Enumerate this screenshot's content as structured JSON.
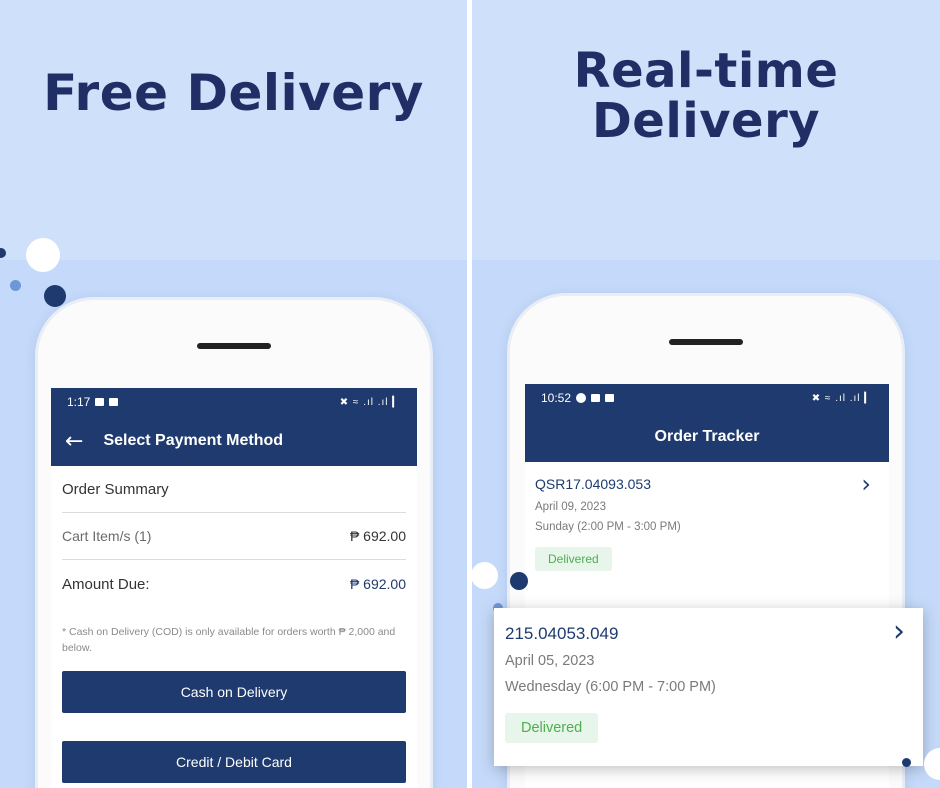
{
  "left_panel": {
    "headline": "Free Delivery",
    "status_time": "1:17",
    "status_icons": "✖ ≈ .ıl .ıl ▎",
    "appbar_title": "Select Payment Method",
    "order_summary_label": "Order Summary",
    "cart_items_label": "Cart Item/s (1)",
    "cart_items_amount": "₱ 692.00",
    "amount_due_label": "Amount Due:",
    "amount_due_value": "₱ 692.00",
    "cod_note": "* Cash on Delivery (COD) is only available for orders worth ₱ 2,000 and below.",
    "cod_button": "Cash on Delivery",
    "card_button": "Credit / Debit Card"
  },
  "right_panel": {
    "headline_line1": "Real-time",
    "headline_line2": "Delivery",
    "status_time": "10:52",
    "status_icons": "✖ ≈ .ıl .ıl ▎",
    "appbar_title": "Order Tracker",
    "orders": [
      {
        "id": "QSR17.04093.053",
        "date": "April 09, 2023",
        "slot": "Sunday (2:00 PM - 3:00 PM)",
        "status": "Delivered"
      },
      {
        "id": "215.04053.049",
        "date": "April 05, 2023",
        "slot": "Wednesday (6:00 PM - 7:00 PM)",
        "status": "Delivered"
      }
    ]
  },
  "icons": {
    "back": "←",
    "chevron": "›"
  },
  "colors": {
    "background": "#cfe0fb",
    "headline": "#1f2f66",
    "primary": "#1f3a6e",
    "badge_bg": "#e8f5ea",
    "badge_text": "#4caf50"
  }
}
